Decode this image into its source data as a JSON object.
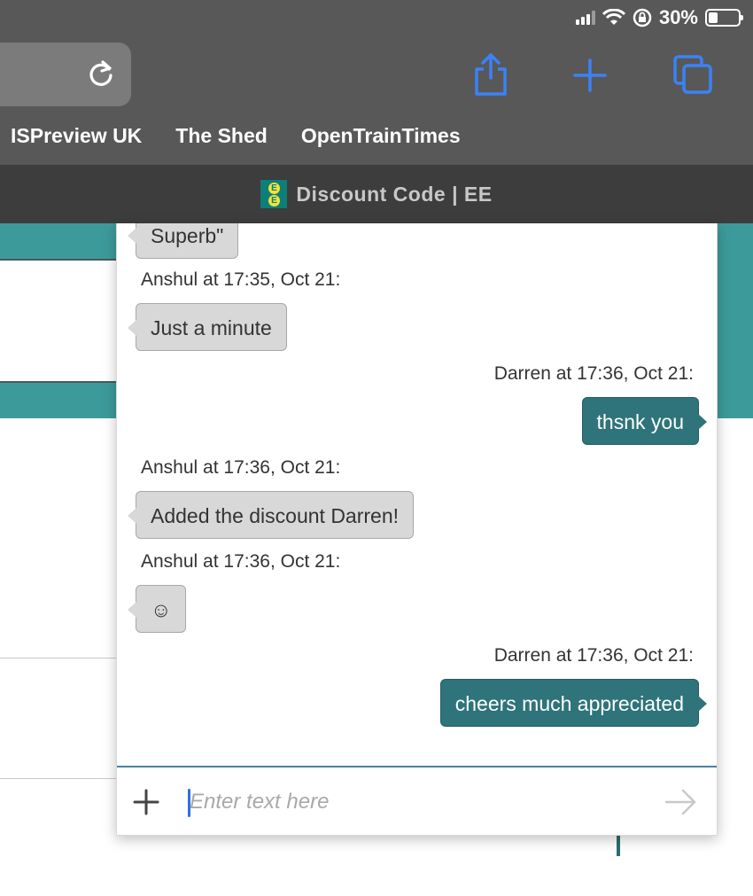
{
  "status_bar": {
    "battery_text": "30%",
    "battery_level": 0.3,
    "icons": [
      "signal-icon",
      "wifi-icon",
      "orientation-lock-icon",
      "battery-icon"
    ]
  },
  "toolbar": {
    "icons": [
      "reload-icon",
      "share-icon",
      "new-tab-icon",
      "tabs-icon"
    ],
    "accent_color": "#3b82f6"
  },
  "favorites": [
    "ISPreview UK",
    "The Shed",
    "OpenTrainTimes"
  ],
  "tab": {
    "title": "Discount Code | EE",
    "logo_letters": [
      "E",
      "E"
    ]
  },
  "chat": {
    "messages": [
      {
        "sender_side": "agent",
        "text": "Superb\""
      },
      {
        "sender_side": "agent",
        "meta": "Anshul at 17:35, Oct 21:",
        "text": "Just a minute"
      },
      {
        "sender_side": "user",
        "meta": "Darren at 17:36, Oct 21:",
        "text": "thsnk you"
      },
      {
        "sender_side": "agent",
        "meta": "Anshul at 17:36, Oct 21:",
        "text": "Added the discount Darren!"
      },
      {
        "sender_side": "agent",
        "meta": "Anshul at 17:36, Oct 21:",
        "text": "☺"
      },
      {
        "sender_side": "user",
        "meta": "Darren at 17:36, Oct 21:",
        "text": "cheers much appreciated"
      }
    ],
    "composer": {
      "placeholder": "Enter text here",
      "value": ""
    },
    "colors": {
      "user_bubble": "#2e747a",
      "agent_bubble": "#d8d8d8"
    }
  }
}
